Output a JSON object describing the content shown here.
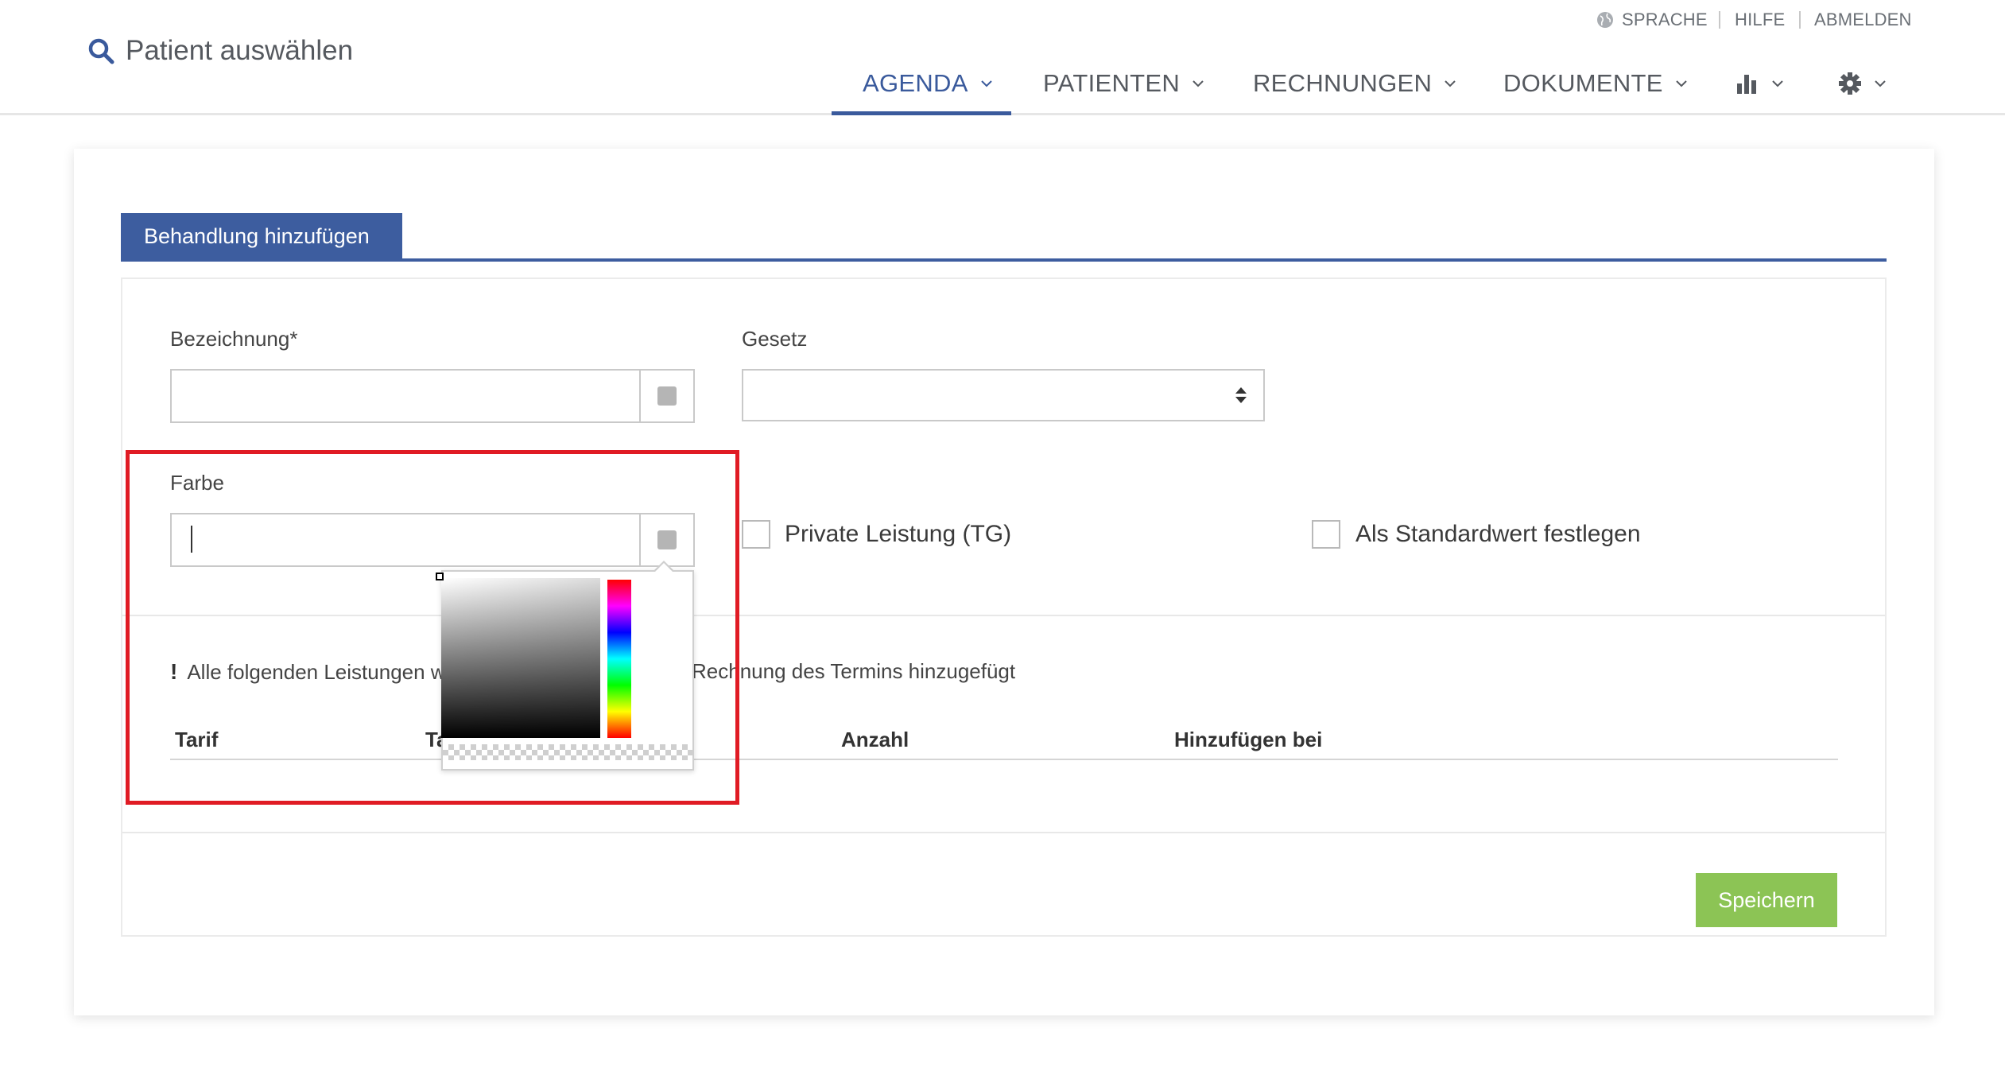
{
  "header": {
    "patient_search": {
      "label": "Patient auswählen",
      "icon": "search-icon"
    },
    "top_links": [
      {
        "label": "SPRACHE",
        "icon": "globe-icon"
      },
      {
        "label": "HILFE"
      },
      {
        "label": "ABMELDEN"
      }
    ],
    "nav": [
      {
        "label": "AGENDA",
        "active": true
      },
      {
        "label": "PATIENTEN"
      },
      {
        "label": "RECHNUNGEN"
      },
      {
        "label": "DOKUMENTE"
      },
      {
        "icon": "bar-chart-icon"
      },
      {
        "icon": "gear-icon"
      }
    ],
    "accent_color": "#3a5a9c"
  },
  "tab": {
    "label": "Behandlung hinzufügen",
    "color": "#3d5d9f"
  },
  "form": {
    "bezeichnung": {
      "label": "Bezeichnung*",
      "value": ""
    },
    "gesetz": {
      "label": "Gesetz",
      "value": ""
    },
    "farbe": {
      "label": "Farbe",
      "value": ""
    },
    "private_leistung": {
      "label": "Private Leistung (TG)",
      "checked": false
    },
    "standardwert": {
      "label": "Als Standardwert festlegen",
      "checked": false
    }
  },
  "info": {
    "mark": "!",
    "text_left": "Alle folgenden Leistungen w",
    "text_right": "Rechnung des Termins hinzugefügt"
  },
  "table": {
    "columns": [
      "Tarif",
      "Ta",
      "Anzahl",
      "Hinzufügen bei"
    ]
  },
  "actions": {
    "save_label": "Speichern",
    "save_color": "#8cc455"
  },
  "color_picker": {
    "open": true
  },
  "highlight_color": "#e01b24"
}
